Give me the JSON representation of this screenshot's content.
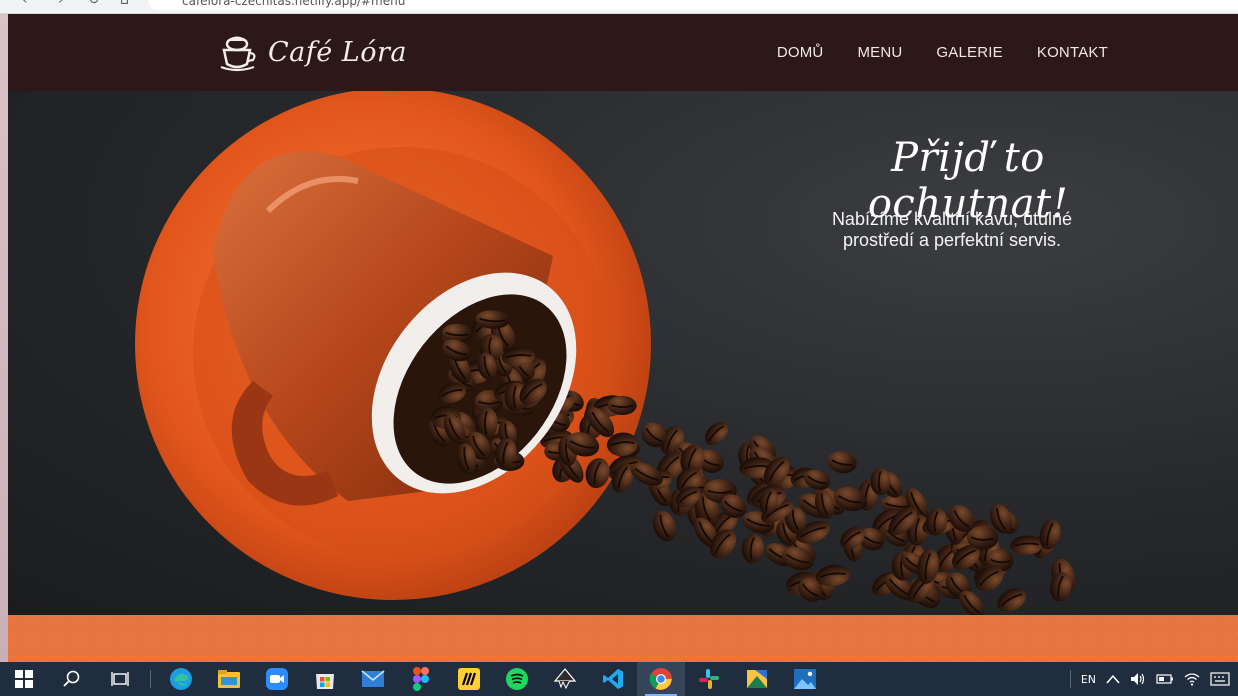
{
  "browser": {
    "url": "cafelora-czechitas.netlify.app/#menu"
  },
  "site": {
    "brand": "Café Lóra",
    "nav": [
      {
        "label": "DOMŮ"
      },
      {
        "label": "MENU"
      },
      {
        "label": "GALERIE"
      },
      {
        "label": "KONTAKT"
      }
    ]
  },
  "hero": {
    "title": "Přijď to ochutnat!",
    "subtitle_line1": "Nabízíme kvalitní kávu, útulné",
    "subtitle_line2": "prostředí a perfektní servis."
  },
  "colors": {
    "header_bg": "#2c1818",
    "accent_orange": "#e8743f",
    "cup_orange": "#e2561c",
    "taskbar_bg": "#202d3f"
  },
  "taskbar": {
    "apps": [
      {
        "name": "windows-start-icon"
      },
      {
        "name": "search-icon"
      },
      {
        "name": "task-view-icon"
      },
      {
        "name": "edge-icon"
      },
      {
        "name": "file-explorer-icon"
      },
      {
        "name": "zoom-icon"
      },
      {
        "name": "microsoft-store-icon"
      },
      {
        "name": "mail-icon"
      },
      {
        "name": "figma-icon"
      },
      {
        "name": "miro-icon"
      },
      {
        "name": "spotify-icon"
      },
      {
        "name": "inkscape-icon"
      },
      {
        "name": "vscode-icon"
      },
      {
        "name": "chrome-icon"
      },
      {
        "name": "slack-icon"
      },
      {
        "name": "sketch-icon"
      },
      {
        "name": "photos-icon"
      }
    ],
    "language": "EN"
  }
}
